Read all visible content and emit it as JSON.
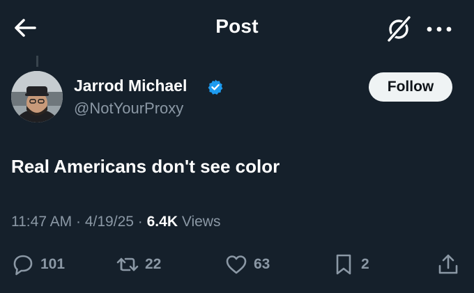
{
  "header": {
    "title": "Post",
    "back_icon": "arrow-left-icon",
    "grok_icon": "grok-icon",
    "more_icon": "more-dots-icon"
  },
  "author": {
    "name": "Jarrod Michael",
    "handle": "@NotYourProxy",
    "verified": true,
    "verified_color": "#1d9bf0",
    "follow_label": "Follow"
  },
  "post": {
    "text": "Real Americans don't see color"
  },
  "meta": {
    "time": "11:47 AM",
    "separator": "·",
    "date": "4/19/25",
    "views_count": "6.4K",
    "views_label": "Views"
  },
  "actions": {
    "replies": "101",
    "reposts": "22",
    "likes": "63",
    "bookmarks": "2"
  },
  "colors": {
    "background": "#15202b",
    "secondary_text": "#8b98a5",
    "primary_text": "#ffffff",
    "accent": "#1d9bf0"
  }
}
